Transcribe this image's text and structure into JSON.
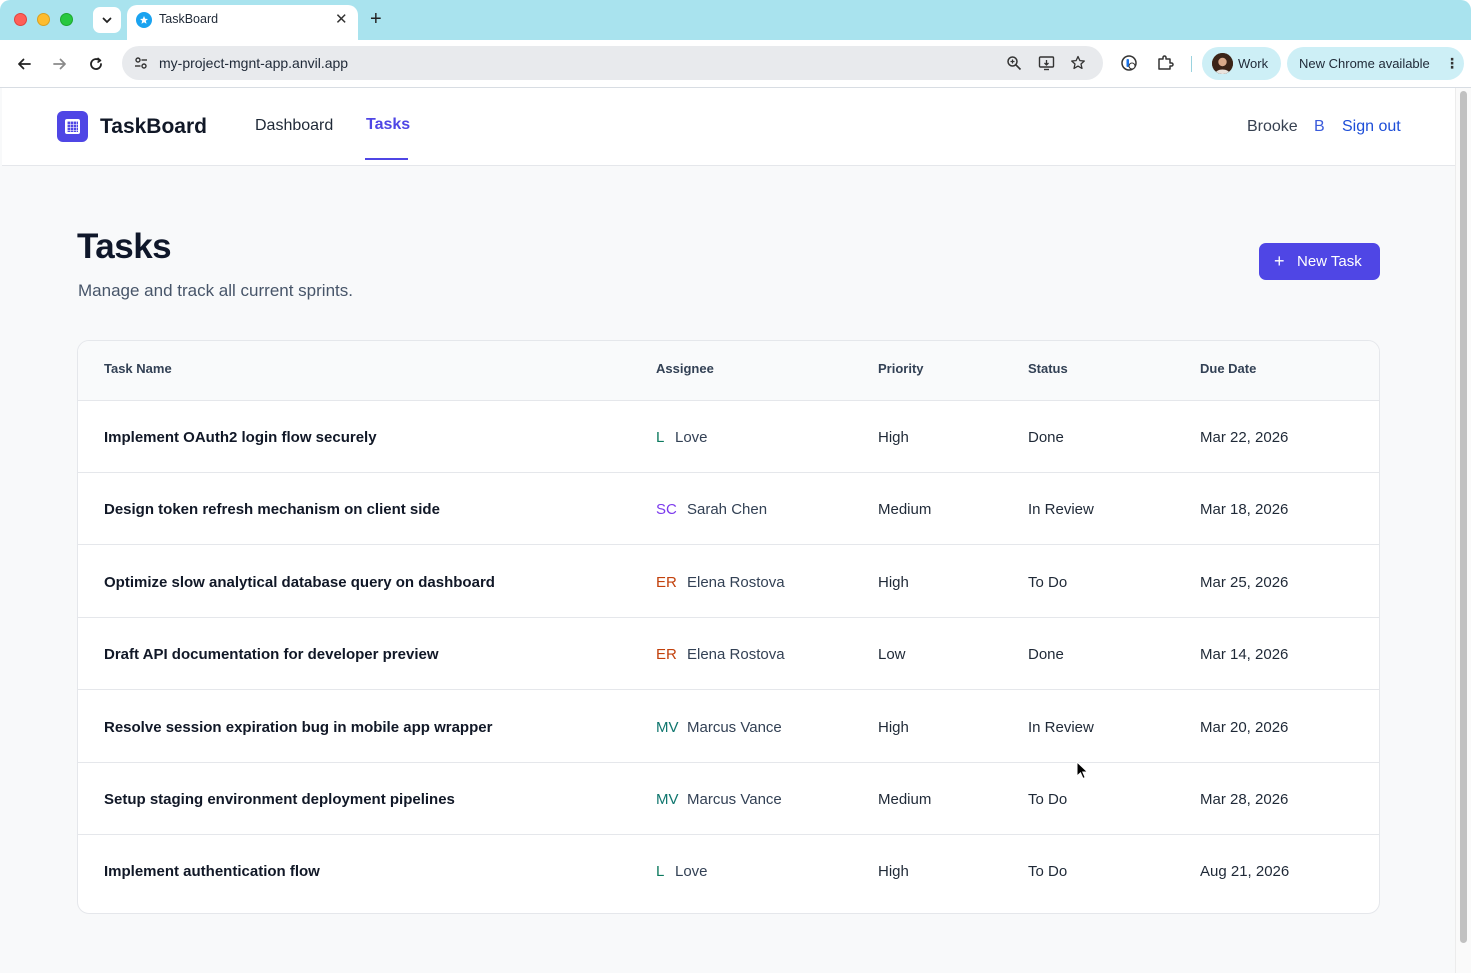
{
  "browser": {
    "tab_title": "TaskBoard",
    "url": "my-project-mgnt-app.anvil.app",
    "profile_label": "Work",
    "update_label": "New Chrome available"
  },
  "app": {
    "brand": "TaskBoard",
    "nav": [
      {
        "label": "Dashboard",
        "active": false
      },
      {
        "label": "Tasks",
        "active": true
      }
    ],
    "user": {
      "name": "Brooke",
      "initial": "B",
      "signout": "Sign out"
    },
    "accent": "#4f46e5"
  },
  "page": {
    "title": "Tasks",
    "subtitle": "Manage and track all current sprints.",
    "new_task_icon": "+",
    "new_task_label": "New Task"
  },
  "table": {
    "columns": [
      "Task Name",
      "Assignee",
      "Priority",
      "Status",
      "Due Date"
    ],
    "rows": [
      {
        "name": "Implement OAuth2 login flow securely",
        "initials": "L",
        "initials_color": "#0d7a5f",
        "assignee": "Love",
        "priority": "High",
        "status": "Done",
        "due": "Mar 22, 2026"
      },
      {
        "name": "Design token refresh mechanism on client side",
        "initials": "SC",
        "initials_color": "#7c3aed",
        "assignee": "Sarah Chen",
        "priority": "Medium",
        "status": "In Review",
        "due": "Mar 18, 2026"
      },
      {
        "name": "Optimize slow analytical database query on dashboard",
        "initials": "ER",
        "initials_color": "#c2410c",
        "assignee": "Elena Rostova",
        "priority": "High",
        "status": "To Do",
        "due": "Mar 25, 2026"
      },
      {
        "name": "Draft API documentation for developer preview",
        "initials": "ER",
        "initials_color": "#c2410c",
        "assignee": "Elena Rostova",
        "priority": "Low",
        "status": "Done",
        "due": "Mar 14, 2026"
      },
      {
        "name": "Resolve session expiration bug in mobile app wrapper",
        "initials": "MV",
        "initials_color": "#0f766e",
        "assignee": "Marcus Vance",
        "priority": "High",
        "status": "In Review",
        "due": "Mar 20, 2026"
      },
      {
        "name": "Setup staging environment deployment pipelines",
        "initials": "MV",
        "initials_color": "#0f766e",
        "assignee": "Marcus Vance",
        "priority": "Medium",
        "status": "To Do",
        "due": "Mar 28, 2026"
      },
      {
        "name": "Implement authentication flow",
        "initials": "L",
        "initials_color": "#0d7a5f",
        "assignee": "Love",
        "priority": "High",
        "status": "To Do",
        "due": "Aug 21, 2026"
      }
    ]
  }
}
